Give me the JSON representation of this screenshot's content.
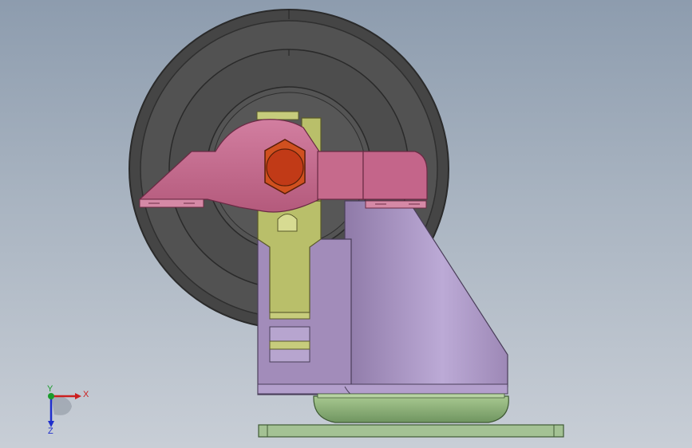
{
  "viewport": {
    "background_top": "#8d9cae",
    "background_bottom": "#c8ced6"
  },
  "model": {
    "parts": [
      {
        "name": "wheel-tire",
        "color": "#4a4a4a"
      },
      {
        "name": "wheel-hub",
        "color": "#5a5a5a"
      },
      {
        "name": "swivel-lock-lever",
        "color": "#c66a8c"
      },
      {
        "name": "axle-hex-nut",
        "color": "#c8401a"
      },
      {
        "name": "brake-pedal",
        "color": "#b9bf6a"
      },
      {
        "name": "fork-bracket",
        "color": "#a58fbd"
      },
      {
        "name": "foot-pad",
        "color": "#8fb07a"
      },
      {
        "name": "base-plate",
        "color": "#a4c294"
      }
    ]
  },
  "triad": {
    "x_label": "X",
    "y_label": "Y",
    "x_color": "#cc1f1f",
    "y_color": "#1a9b2b",
    "z_color": "#1f2fcc",
    "z_label": "Z"
  }
}
